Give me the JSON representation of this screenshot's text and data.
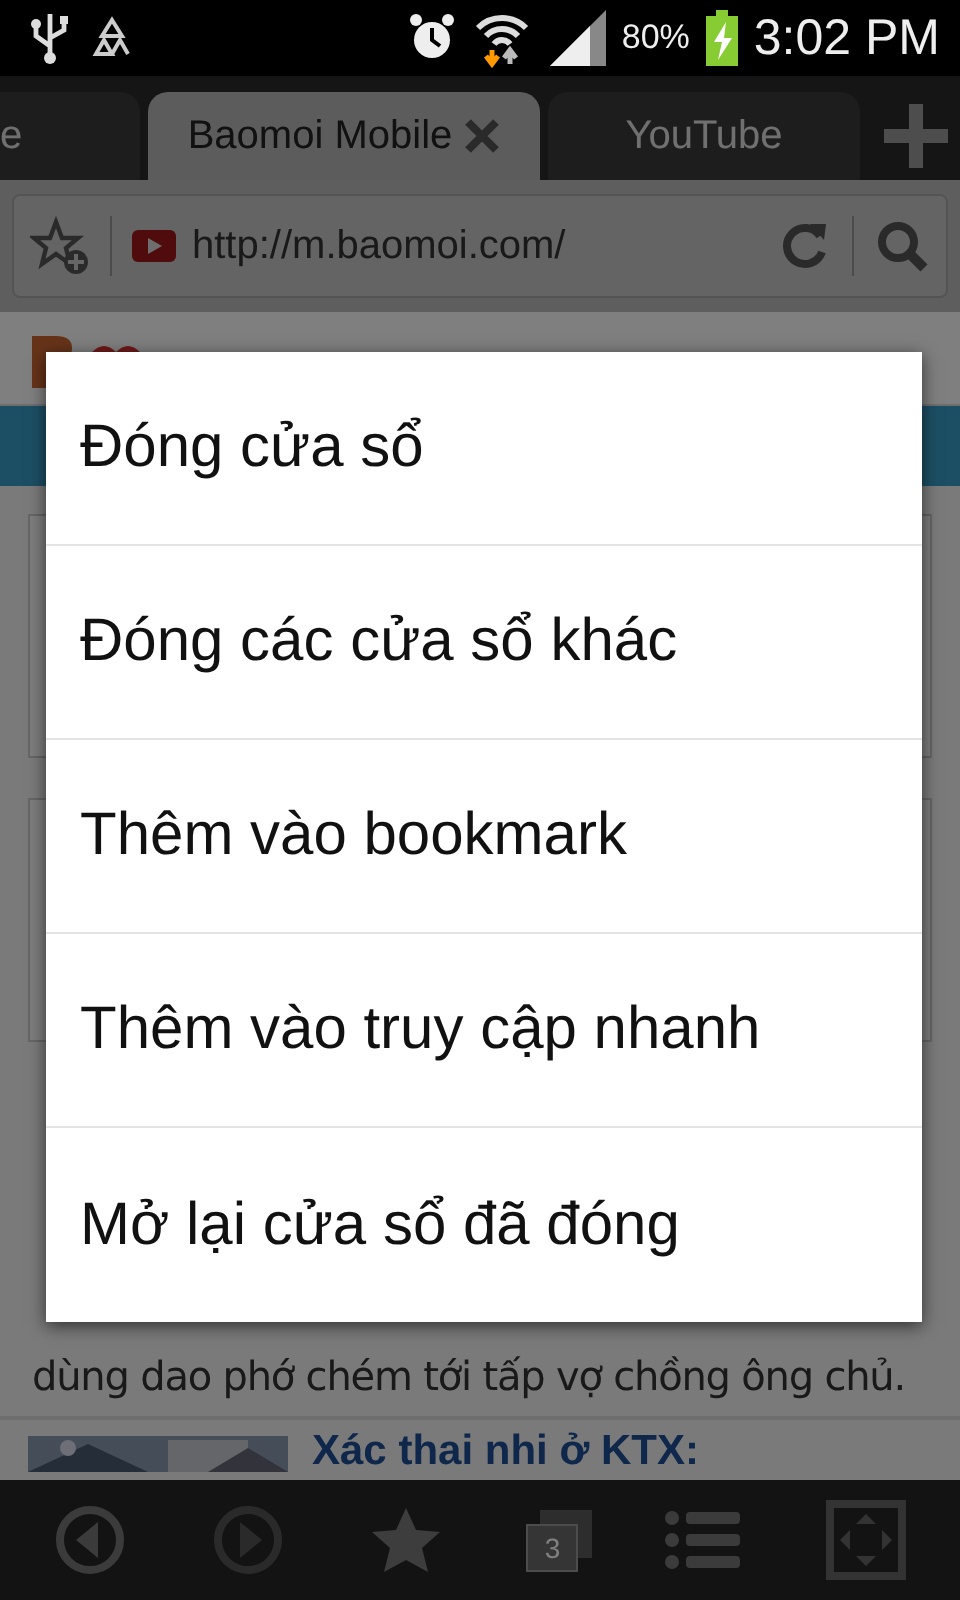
{
  "status_bar": {
    "battery": "80%",
    "time": "3:02 PM"
  },
  "tabs": [
    {
      "label": "e",
      "selected": false
    },
    {
      "label": "Baomoi Mobile",
      "selected": true
    },
    {
      "label": "YouTube",
      "selected": false
    }
  ],
  "address_bar": {
    "url": "http://m.baomoi.com/"
  },
  "page": {
    "paragraph": "dùng dao phớ chém tới tấp vợ chồng ông chủ.",
    "headline": "Xác thai nhi ở KTX:"
  },
  "menu": {
    "items": [
      "Đóng cửa sổ",
      "Đóng các cửa sổ khác",
      "Thêm vào bookmark",
      "Thêm vào truy cập nhanh",
      "Mở lại cửa sổ đã đóng"
    ]
  },
  "toolbar": {
    "tab_count": "3"
  }
}
